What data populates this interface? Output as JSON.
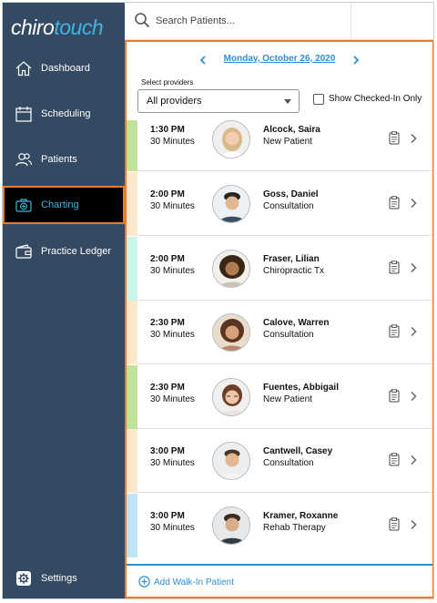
{
  "app": {
    "logo_part1": "chiro",
    "logo_part2": "touch",
    "accent_color": "#3fb5e4",
    "highlight_color": "#ee7a2a"
  },
  "search": {
    "placeholder": "Search Patients..."
  },
  "sidebar": {
    "items": [
      {
        "label": "Dashboard",
        "icon": "home-icon"
      },
      {
        "label": "Scheduling",
        "icon": "calendar-icon"
      },
      {
        "label": "Patients",
        "icon": "users-icon"
      },
      {
        "label": "Charting",
        "icon": "medical-kit-icon",
        "active": true
      },
      {
        "label": "Practice Ledger",
        "icon": "wallet-icon"
      }
    ],
    "settings_label": "Settings"
  },
  "main": {
    "date": "Monday, October 26, 2020",
    "providers_label": "Select providers",
    "providers_value": "All providers",
    "checked_in_label": "Show Checked-In Only",
    "walkin_label": "Add Walk-In Patient"
  },
  "appointments": [
    {
      "time": "1:30 PM",
      "duration": "30 Minutes",
      "name": "Alcock, Saira",
      "type": "New Patient",
      "color": "#bfe39a"
    },
    {
      "time": "2:00 PM",
      "duration": "30 Minutes",
      "name": "Goss, Daniel",
      "type": "Consultation",
      "color": "#fde8cf"
    },
    {
      "time": "2:00 PM",
      "duration": "30 Minutes",
      "name": "Fraser, Lilian",
      "type": "Chiropractic Tx",
      "color": "#c9f4ec"
    },
    {
      "time": "2:30 PM",
      "duration": "30 Minutes",
      "name": "Calove, Warren",
      "type": "Consultation",
      "color": "#fde8cf"
    },
    {
      "time": "2:30 PM",
      "duration": "30 Minutes",
      "name": "Fuentes, Abbigail",
      "type": "New Patient",
      "color": "#bfe39a"
    },
    {
      "time": "3:00 PM",
      "duration": "30 Minutes",
      "name": "Cantwell, Casey",
      "type": "Consultation",
      "color": "#fde8cf"
    },
    {
      "time": "3:00 PM",
      "duration": "30 Minutes",
      "name": "Kramer, Roxanne",
      "type": "Rehab Therapy",
      "color": "#bfe4f7"
    }
  ]
}
